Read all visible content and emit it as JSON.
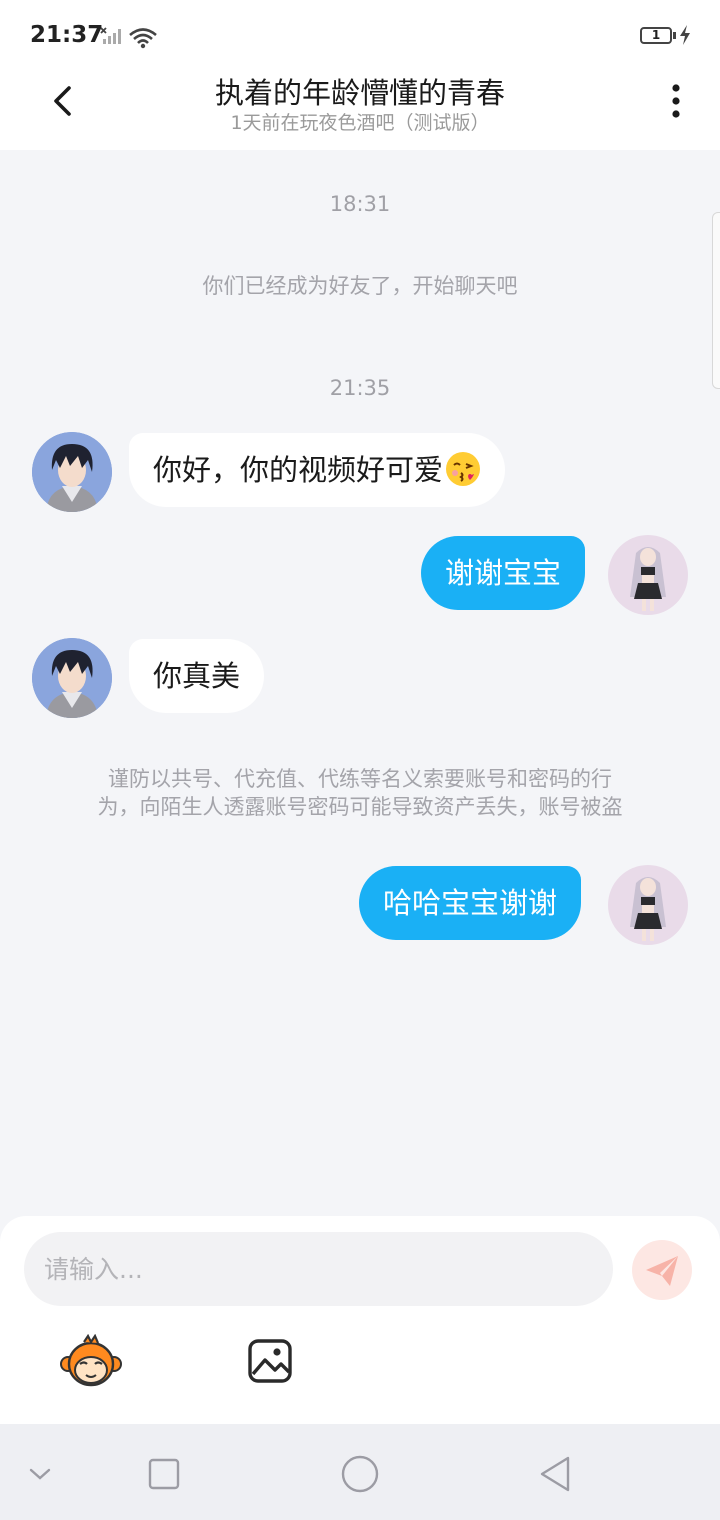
{
  "status_bar": {
    "time": "21:37",
    "battery": "1"
  },
  "header": {
    "title": "执着的年龄懵懂的青春",
    "subtitle": "1天前在玩夜色酒吧（测试版）"
  },
  "chat": {
    "timestamp_1": "18:31",
    "system_friend": "你们已经成为好友了，开始聊天吧",
    "timestamp_2": "21:35",
    "msg_1": "你好，你的视频好可爱",
    "msg_2": "谢谢宝宝",
    "msg_3": "你真美",
    "warning_line_1": "谨防以共号、代充值、代练等名义索要账号和密码的行",
    "warning_line_2": "为，向陌生人透露账号密码可能导致资产丢失，账号被盗",
    "msg_4": "哈哈宝宝谢谢"
  },
  "input": {
    "placeholder": "请输入..."
  },
  "colors": {
    "accent": "#1ab0f5",
    "background": "#f4f5f8"
  }
}
